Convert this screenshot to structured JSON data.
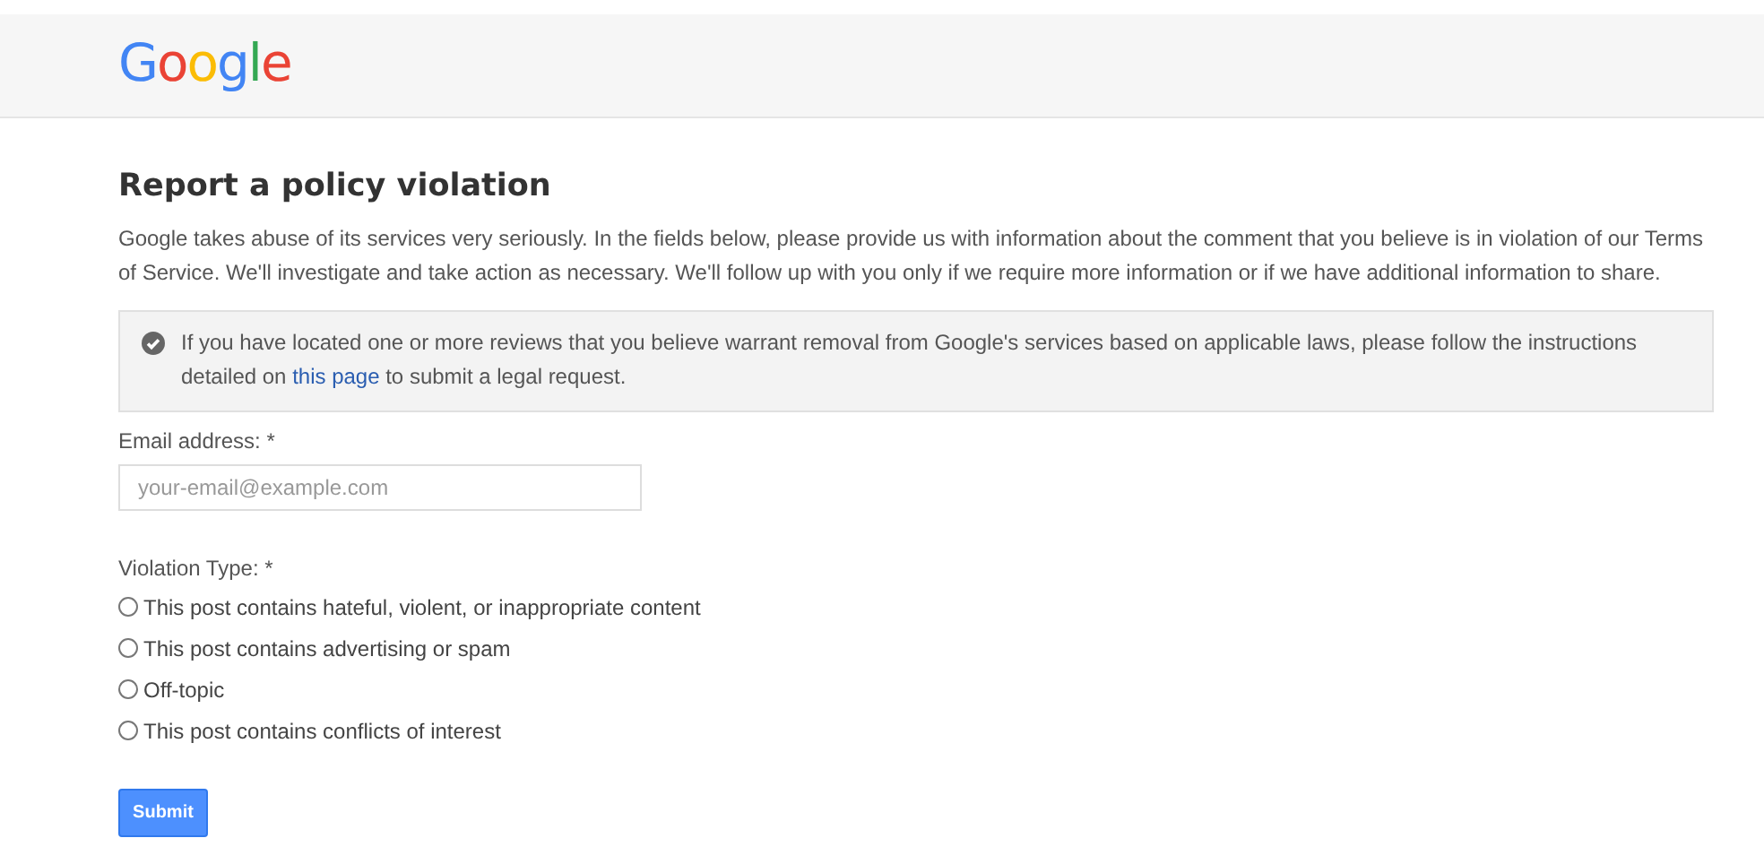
{
  "header": {
    "logo": "Google"
  },
  "title": "Report a policy violation",
  "intro": "Google takes abuse of its services very seriously. In the fields below, please provide us with information about the comment that you believe is in violation of our Terms of Service. We'll investigate and take action as necessary. We'll follow up with you only if we require more information or if we have additional information to share.",
  "notice": {
    "text_before": "If you have located one or more reviews that you believe warrant removal from Google's services based on applicable laws, please follow the instructions detailed on ",
    "link": "this page",
    "text_after": " to submit a legal request."
  },
  "email": {
    "label": "Email address: *",
    "placeholder": "your-email@example.com"
  },
  "violation_type": {
    "label": "Violation Type: *",
    "options": [
      {
        "label": "This post contains hateful, violent, or inappropriate content",
        "selected": false
      },
      {
        "label": "This post contains advertising or spam",
        "selected": false
      },
      {
        "label": "Off-topic",
        "selected": false
      },
      {
        "label": "This post contains conflicts of interest",
        "selected": false
      }
    ]
  },
  "submit": "Submit"
}
